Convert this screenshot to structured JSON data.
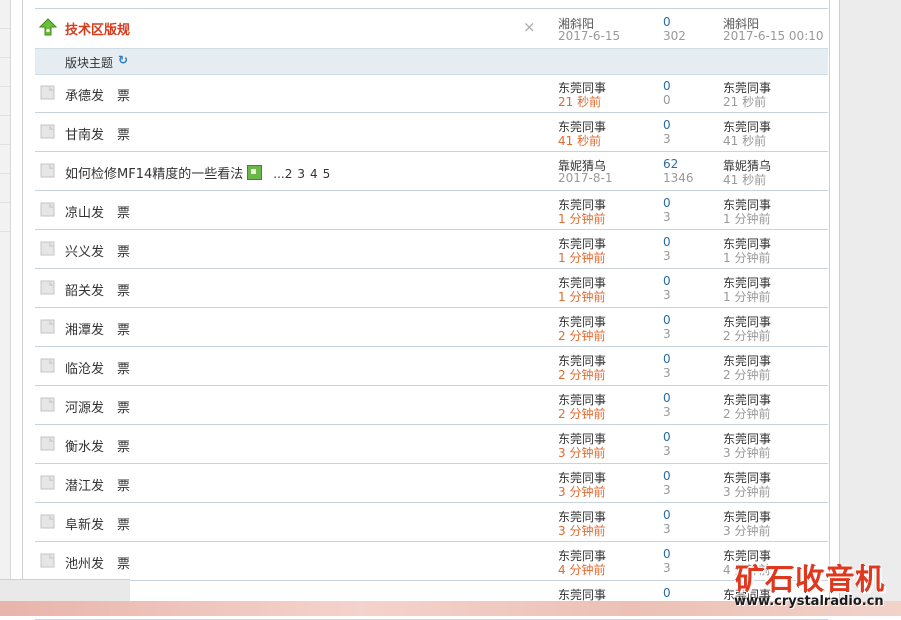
{
  "sticky": {
    "title": "技术区版规",
    "close_glyph": "×",
    "author": "湘斜阳",
    "date": "2017-6-15",
    "replies": "0",
    "views": "302",
    "last_user": "湘斜阳",
    "last_time": "2017-6-15 00:10"
  },
  "section": {
    "label": "版块主题",
    "refresh_glyph": "↻"
  },
  "threads": [
    {
      "title": "承德发　票",
      "author": "东莞同事",
      "time": "21 秒前",
      "replies": "0",
      "views": "0",
      "last_user": "东莞同事",
      "last_time": "21 秒前"
    },
    {
      "title": "甘南发　票",
      "author": "东莞同事",
      "time": "41 秒前",
      "replies": "0",
      "views": "3",
      "last_user": "东莞同事",
      "last_time": "41 秒前"
    },
    {
      "title": "如何检修MF14精度的一些看法",
      "author": "靠妮猜乌",
      "time": "2017-8-1",
      "replies": "62",
      "views": "1346",
      "last_user": "靠妮猜乌",
      "last_time": "41 秒前",
      "pages": [
        "...2",
        "3",
        "4",
        "5"
      ]
    },
    {
      "title": "凉山发　票",
      "author": "东莞同事",
      "time": "1 分钟前",
      "replies": "0",
      "views": "3",
      "last_user": "东莞同事",
      "last_time": "1 分钟前"
    },
    {
      "title": "兴义发　票",
      "author": "东莞同事",
      "time": "1 分钟前",
      "replies": "0",
      "views": "3",
      "last_user": "东莞同事",
      "last_time": "1 分钟前"
    },
    {
      "title": "韶关发　票",
      "author": "东莞同事",
      "time": "1 分钟前",
      "replies": "0",
      "views": "3",
      "last_user": "东莞同事",
      "last_time": "1 分钟前"
    },
    {
      "title": "湘潭发　票",
      "author": "东莞同事",
      "time": "2 分钟前",
      "replies": "0",
      "views": "3",
      "last_user": "东莞同事",
      "last_time": "2 分钟前"
    },
    {
      "title": "临沧发　票",
      "author": "东莞同事",
      "time": "2 分钟前",
      "replies": "0",
      "views": "3",
      "last_user": "东莞同事",
      "last_time": "2 分钟前"
    },
    {
      "title": "河源发　票",
      "author": "东莞同事",
      "time": "2 分钟前",
      "replies": "0",
      "views": "3",
      "last_user": "东莞同事",
      "last_time": "2 分钟前"
    },
    {
      "title": "衡水发　票",
      "author": "东莞同事",
      "time": "3 分钟前",
      "replies": "0",
      "views": "3",
      "last_user": "东莞同事",
      "last_time": "3 分钟前"
    },
    {
      "title": "潜江发　票",
      "author": "东莞同事",
      "time": "3 分钟前",
      "replies": "0",
      "views": "3",
      "last_user": "东莞同事",
      "last_time": "3 分钟前"
    },
    {
      "title": "阜新发　票",
      "author": "东莞同事",
      "time": "3 分钟前",
      "replies": "0",
      "views": "3",
      "last_user": "东莞同事",
      "last_time": "3 分钟前"
    },
    {
      "title": "池州发　票",
      "author": "东莞同事",
      "time": "4 分钟前",
      "replies": "0",
      "views": "3",
      "last_user": "东莞同事",
      "last_time": "4 分钟前"
    },
    {
      "title": "",
      "author": "东莞同事",
      "time": "",
      "replies": "0",
      "views": "",
      "last_user": "东莞同事",
      "last_time": ""
    }
  ],
  "watermark": {
    "name": "矿石收音机",
    "url": "www.crystalradio.cn"
  },
  "colors": {
    "sticky_title": "#d63b1e",
    "recent_time": "#e06a30",
    "count": "#2b6ca3",
    "divider": "#c8d4dd"
  },
  "icons": {
    "sticky": "up-arrow-icon",
    "thread": "folder-icon",
    "attachment": "image-attachment-icon",
    "refresh": "refresh-icon"
  }
}
